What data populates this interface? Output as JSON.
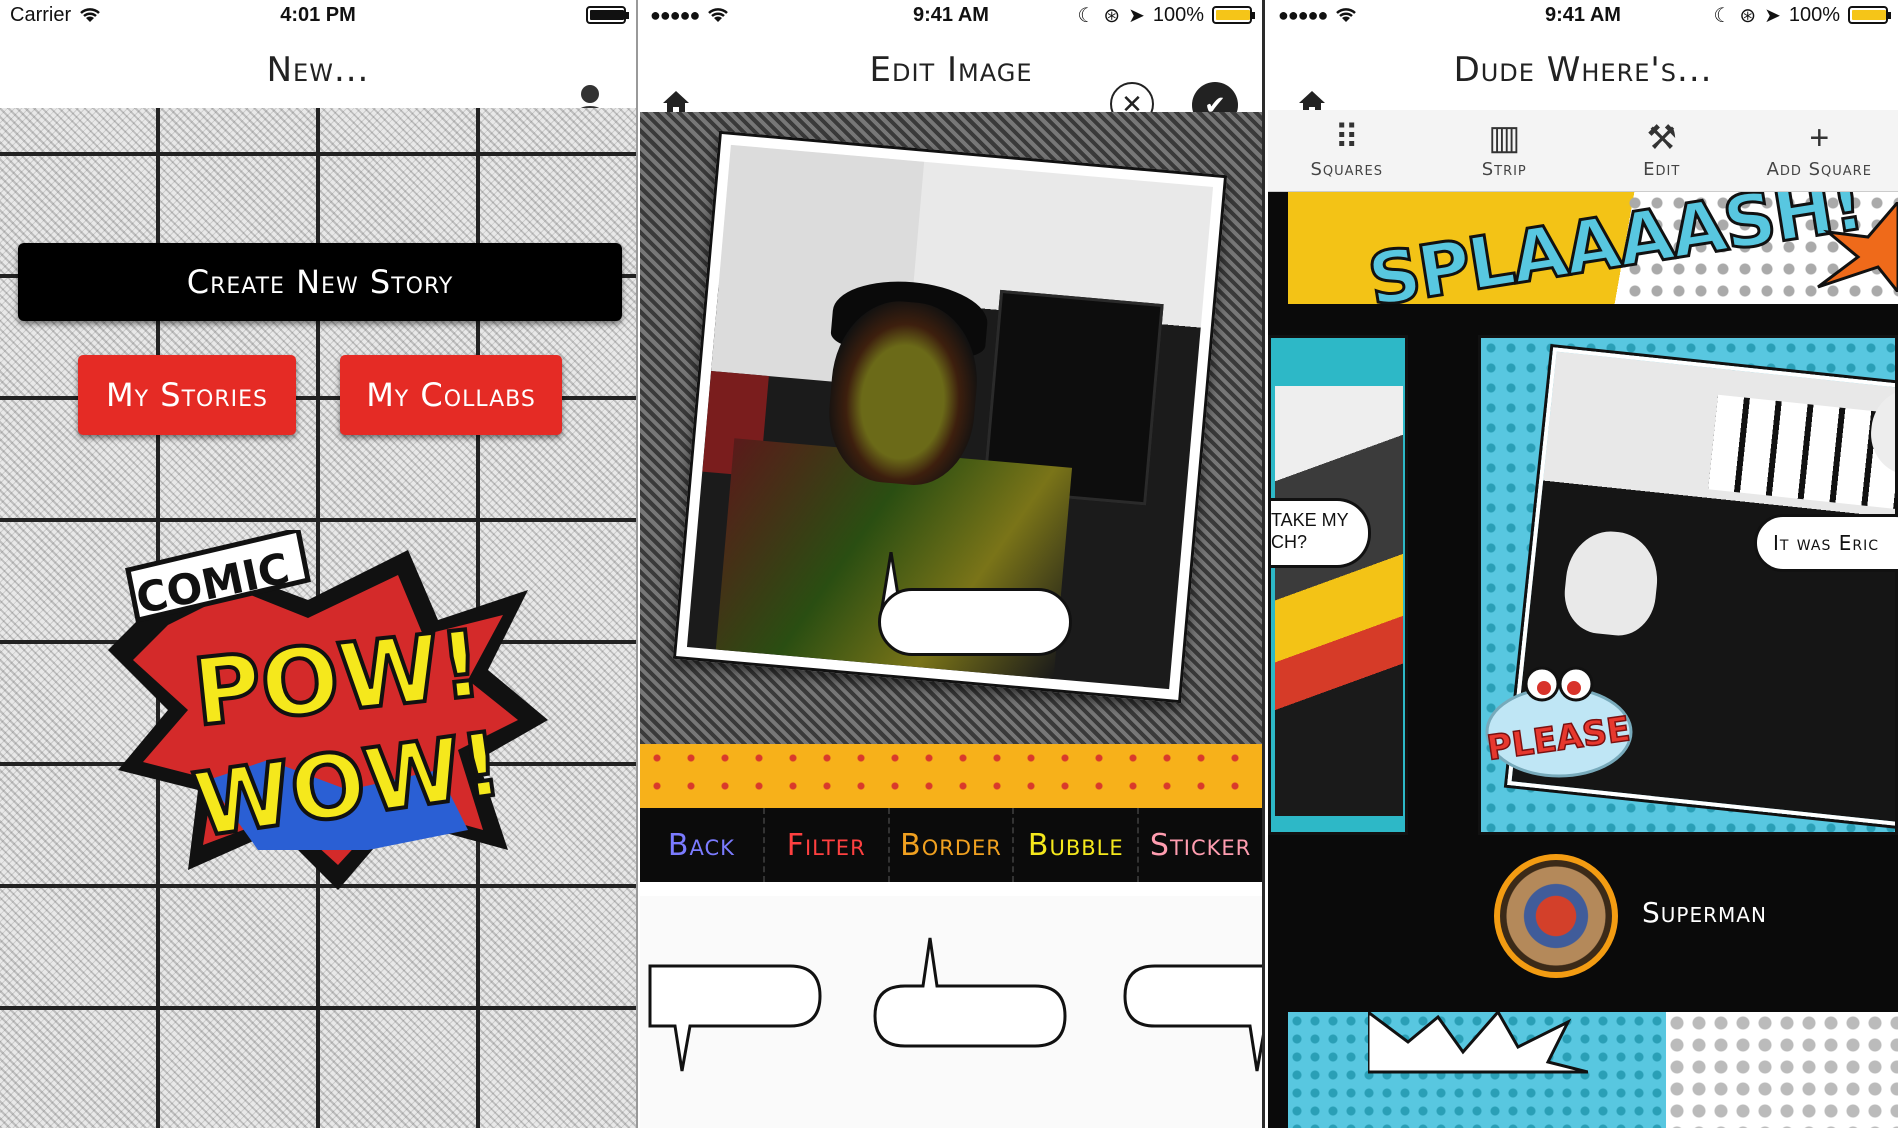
{
  "screen1": {
    "status": {
      "carrier": "Carrier",
      "time": "4:01 PM"
    },
    "nav": {
      "title": "New..."
    },
    "buttons": {
      "create_new_story": "Create New Story",
      "my_stories": "My Stories",
      "my_collabs": "My Collabs"
    },
    "logo": {
      "line1": "COMIC",
      "line2": "POW!",
      "line3": "WOW!"
    }
  },
  "screen2": {
    "status": {
      "time": "9:41 AM",
      "battery": "100%"
    },
    "nav": {
      "title": "Edit Image"
    },
    "tabs": [
      {
        "label": "Back",
        "color": "#7b7bff"
      },
      {
        "label": "Filter",
        "color": "#ff4040"
      },
      {
        "label": "Border",
        "color": "#f0a020"
      },
      {
        "label": "Bubble",
        "color": "#f5e81c"
      },
      {
        "label": "Sticker",
        "color": "#ff9db0"
      }
    ]
  },
  "screen3": {
    "status": {
      "time": "9:41 AM",
      "battery": "100%"
    },
    "nav": {
      "title": "Dude Where's..."
    },
    "toolbar": [
      {
        "label": "Squares",
        "icon": "grid-icon"
      },
      {
        "label": "Strip",
        "icon": "strip-icon"
      },
      {
        "label": "Edit",
        "icon": "tools-icon"
      },
      {
        "label": "Add Square",
        "icon": "plus-icon"
      }
    ],
    "panels": {
      "splash": "SPLAAAASH!",
      "bubble_left": "TAKE MY\nCH?",
      "bubble_right": "It was Eric",
      "sticker": "PLEASE"
    },
    "author": {
      "name": "Superman"
    }
  }
}
